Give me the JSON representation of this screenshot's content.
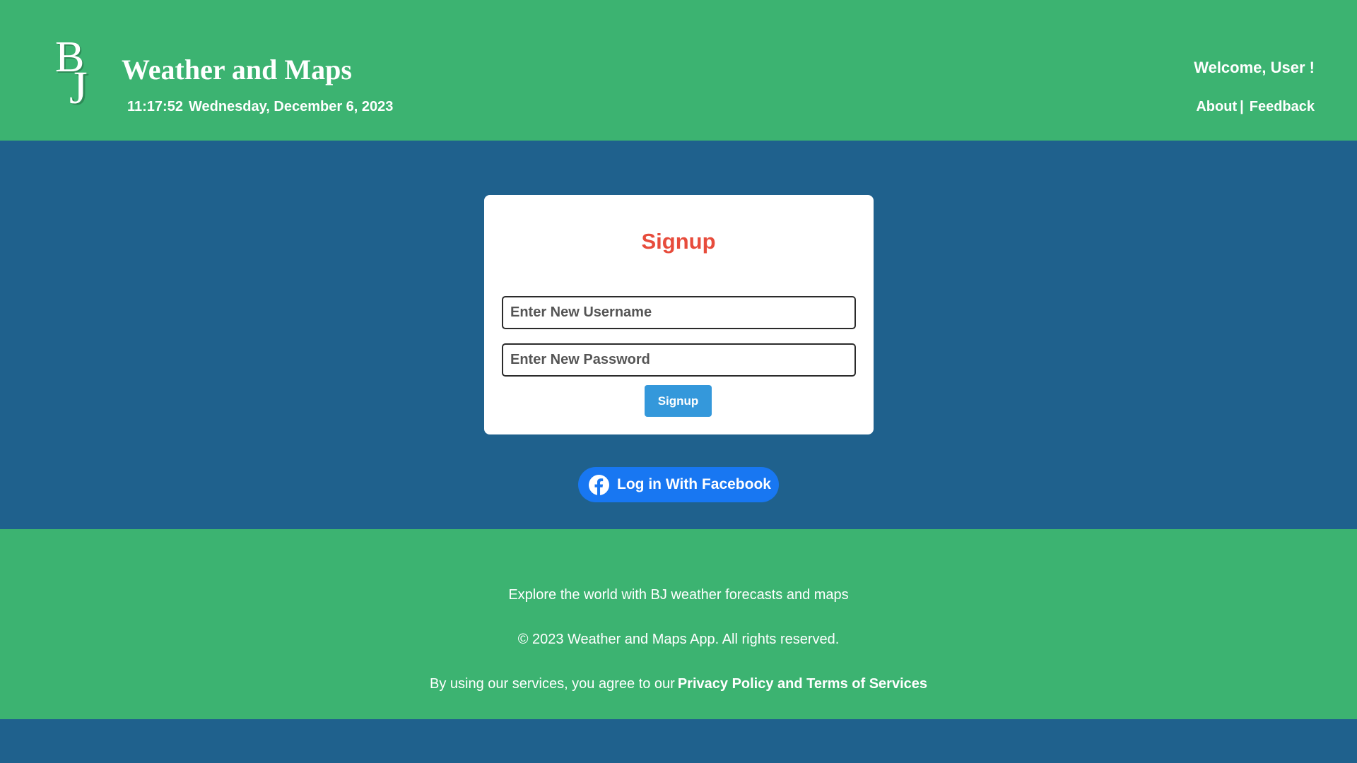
{
  "header": {
    "logo_text": "BJ",
    "logo_b": "B",
    "logo_j": "J",
    "title": "Weather and Maps",
    "time": "11:17:52",
    "date": "Wednesday, December 6, 2023",
    "welcome": "Welcome, User !",
    "nav": {
      "about": "About",
      "separator": "|",
      "feedback": "Feedback"
    }
  },
  "signup_form": {
    "title": "Signup",
    "username": {
      "value": "",
      "placeholder": "Enter New Username"
    },
    "password": {
      "value": "",
      "placeholder": "Enter New Password"
    },
    "submit_label": "Signup"
  },
  "facebook_login": {
    "label": "Log in With Facebook",
    "icon": "facebook-icon"
  },
  "footer": {
    "tagline": "Explore the world with BJ weather forecasts and maps",
    "copyright": "© 2023 Weather and Maps App. All rights reserved.",
    "agreement_text": "By using our services, you agree to our",
    "policy_link": "Privacy Policy and Terms of Services"
  },
  "colors": {
    "header_footer_bg": "#3cb371",
    "page_bg": "#1f618d",
    "signup_title": "#e74c3c",
    "signup_button": "#3498db",
    "facebook_button": "#1877f2"
  }
}
